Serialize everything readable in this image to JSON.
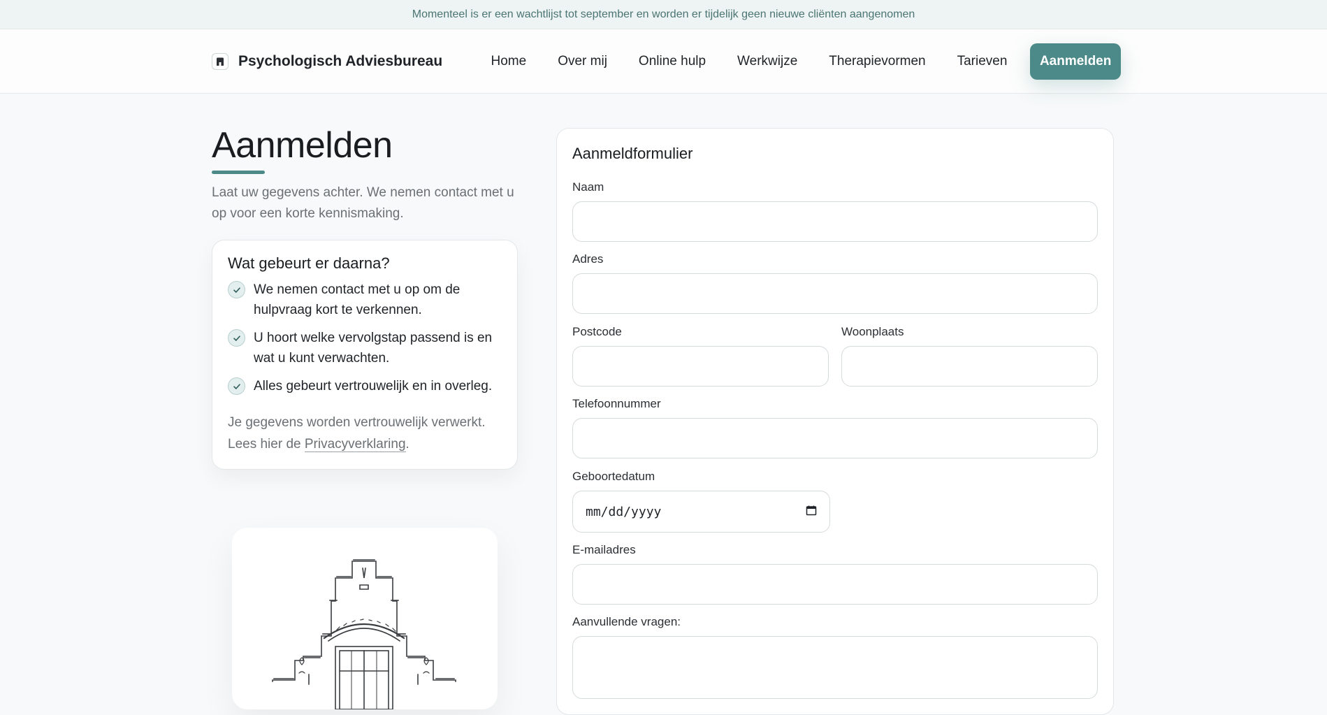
{
  "notice": {
    "text": "Momenteel is er een wachtlijst tot september en worden er tijdelijk geen nieuwe cliënten aangenomen"
  },
  "brand": {
    "name": "Psychologisch Adviesbureau",
    "icon": "building-icon"
  },
  "nav": {
    "items": [
      "Home",
      "Over mij",
      "Online hulp",
      "Werkwijze",
      "Therapievormen",
      "Tarieven"
    ],
    "cta": "Aanmelden"
  },
  "colors": {
    "accent": "#4b8a88",
    "notice_text": "#4a7574"
  },
  "intro": {
    "title": "Aanmelden",
    "text": "Laat uw gegevens achter. We nemen contact met u op voor een korte kennismaking."
  },
  "info": {
    "title": "Wat gebeurt er daarna?",
    "items": [
      "We nemen contact met u op om de hulpvraag kort te verkennen.",
      "U hoort welke vervolgstap passend is en wat u kunt verwachten.",
      "Alles gebeurt vertrouwelijk en in overleg."
    ],
    "privacy_text": "Je gegevens worden vertrouwelijk verwerkt. Lees hier de ",
    "privacy_link": "Privacyverklaring",
    "privacy_end": "."
  },
  "form": {
    "title": "Aanmeldformulier",
    "labels": {
      "name": "Naam",
      "address": "Adres",
      "postcode": "Postcode",
      "city": "Woonplaats",
      "phone": "Telefoonnummer",
      "birthdate": "Geboortedatum",
      "email": "E-mailadres",
      "questions": "Aanvullende vragen:"
    },
    "birthdate_placeholder": "mm/dd/yyyy"
  }
}
